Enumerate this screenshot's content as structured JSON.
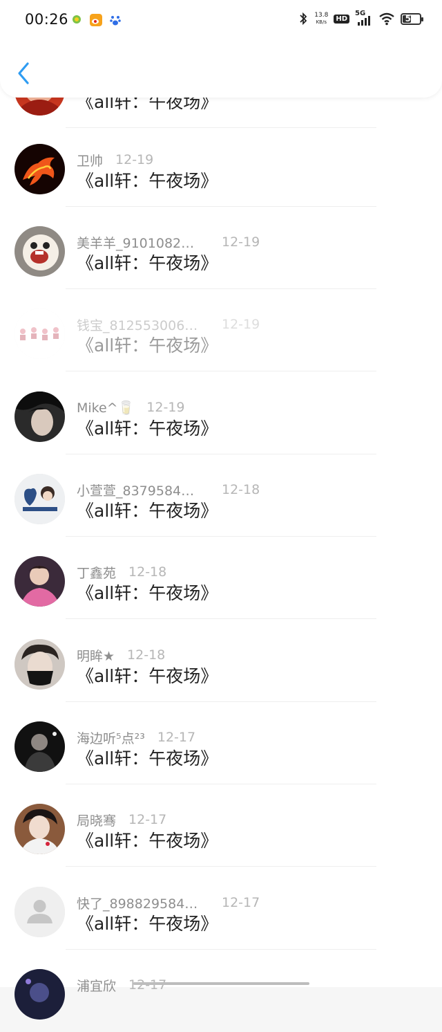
{
  "status_bar": {
    "time": "00:26",
    "net_speed_value": "13.8",
    "net_speed_unit": "KB/s",
    "hd": "HD",
    "network": "5G",
    "battery": "52",
    "icons": [
      "app-notification-icon",
      "weibo-icon",
      "baidu-icon",
      "bluetooth-icon",
      "signal-icon",
      "wifi-icon",
      "battery-icon"
    ]
  },
  "header": {
    "back_icon": "chevron-left-icon",
    "accent": "#2e9cf2"
  },
  "comments": [
    {
      "name": "",
      "date": "",
      "title": "《all轩：午夜场》",
      "avatar": "red-flame"
    },
    {
      "name": "卫帅",
      "date": "12-19",
      "title": "《all轩：午夜场》",
      "avatar": "fire-horse"
    },
    {
      "name": "美羊羊_9101082…",
      "date": "12-19",
      "title": "《all轩：午夜场》",
      "avatar": "cartoon-face"
    },
    {
      "name": "钱宝_812553006…",
      "date": "12-19",
      "title": "《all轩：午夜场》",
      "avatar": "pink-figures"
    },
    {
      "name": "Mike^🥛",
      "date": "12-19",
      "title": "《all轩：午夜场》",
      "avatar": "dark-portrait"
    },
    {
      "name": "小萱萱_8379584…",
      "date": "12-18",
      "title": "《all轩：午夜场》",
      "avatar": "blue-heart-couple"
    },
    {
      "name": "丁鑫苑",
      "date": "12-18",
      "title": "《all轩：午夜场》",
      "avatar": "pink-portrait"
    },
    {
      "name": "明眸★",
      "date": "12-18",
      "title": "《all轩：午夜场》",
      "avatar": "masked-portrait"
    },
    {
      "name": "海边听⁵点²³",
      "date": "12-17",
      "title": "《all轩：午夜场》",
      "avatar": "stage-portrait"
    },
    {
      "name": "局晓骞",
      "date": "12-17",
      "title": "《all轩：午夜场》",
      "avatar": "white-shirt-portrait"
    },
    {
      "name": "快了_898829584…",
      "date": "12-17",
      "title": "《all轩：午夜场》",
      "avatar": "default-user"
    },
    {
      "name": "浦宜欣",
      "date": "12-17",
      "title": "",
      "avatar": "night-portrait"
    }
  ]
}
